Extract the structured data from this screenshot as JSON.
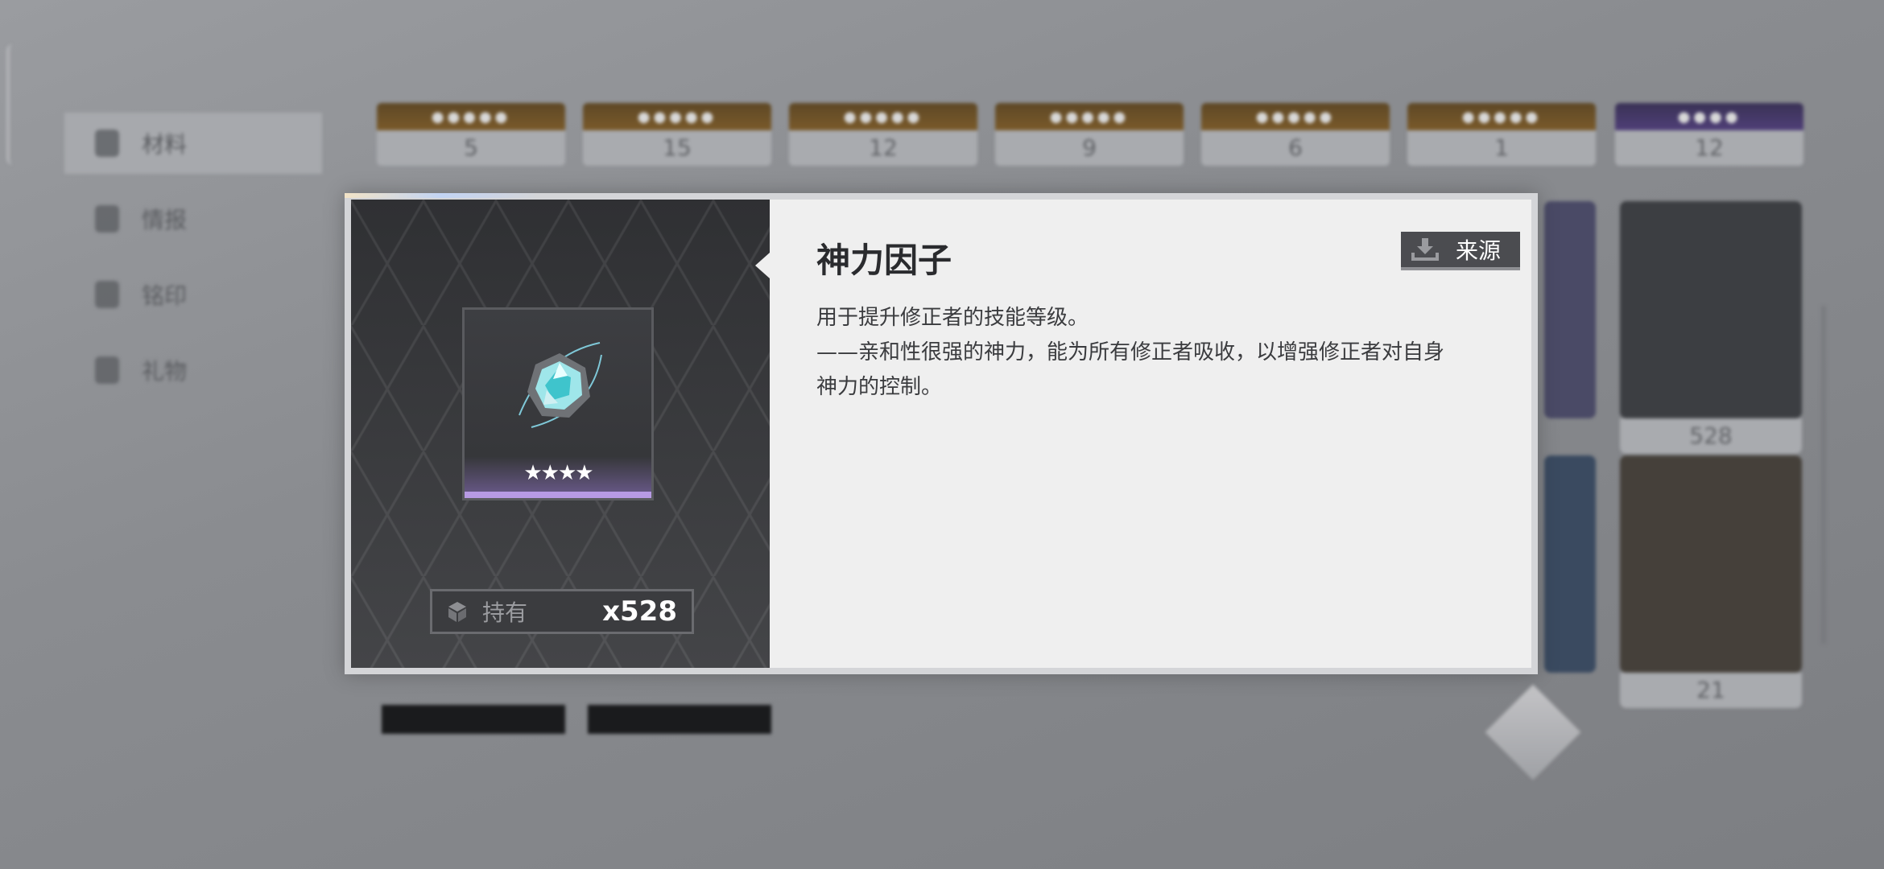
{
  "item": {
    "name": "神力因子",
    "stars": "★★★★",
    "owned_label": "持有",
    "owned_count": "x528",
    "source_label": "来源",
    "description": [
      "用于提升修正者的技能等级。",
      "——亲和性很强的神力，能为所有修正者吸收，以增强修正者对自身",
      "神力的控制。"
    ]
  },
  "background": {
    "sidebar": [
      {
        "label": "材料",
        "icon": "materials-icon"
      },
      {
        "label": "情报",
        "icon": "intel-icon"
      },
      {
        "label": "铭印",
        "icon": "imprint-icon"
      },
      {
        "label": "礼物",
        "icon": "gift-icon"
      }
    ],
    "top_row_counts": [
      "5",
      "15",
      "12",
      "9",
      "6",
      "1",
      "12"
    ],
    "grid_counts": [
      "528",
      "21"
    ]
  },
  "colors": {
    "rarity_purple": "#b79ae4",
    "panel_dark": "#36373a",
    "panel_light": "#efefef",
    "button_dark": "#4b4c50"
  }
}
